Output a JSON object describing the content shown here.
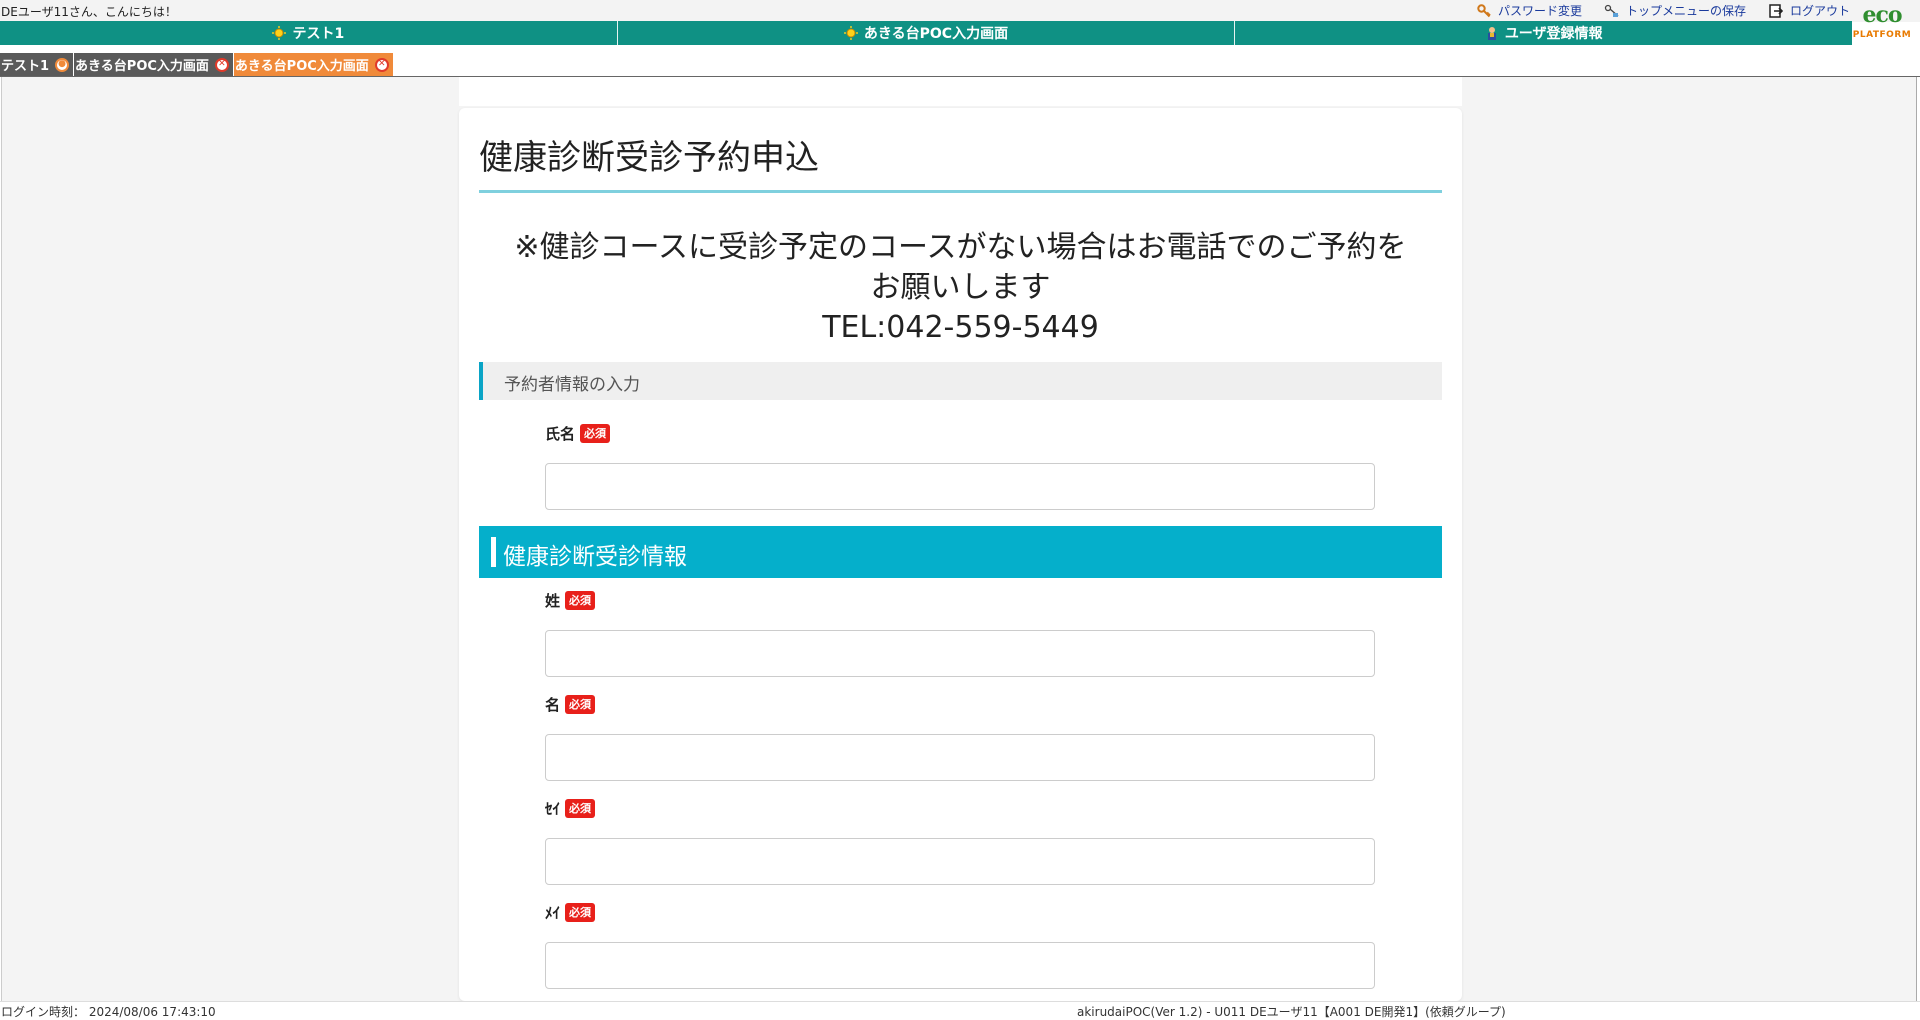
{
  "header": {
    "greeting": "DEユーザ11さん、こんにちは！",
    "links": [
      {
        "label": "パスワード変更",
        "icon": "key-icon"
      },
      {
        "label": "トップメニューの保存",
        "icon": "save-menu-icon"
      },
      {
        "label": "ログアウト",
        "icon": "logout-icon"
      }
    ],
    "logo": {
      "mark": "eco",
      "sub": "PLATFORM"
    }
  },
  "nav": {
    "items": [
      {
        "label": "テスト1",
        "icon": "sun-icon"
      },
      {
        "label": "あきる台POC入力画面",
        "icon": "sun-icon"
      },
      {
        "label": "ユーザ登録情報",
        "icon": "user-icon"
      }
    ]
  },
  "tabs": [
    {
      "label": "テスト1",
      "state": "normal"
    },
    {
      "label": "あきる台POC入力画面",
      "state": "normal"
    },
    {
      "label": "あきる台POC入力画面",
      "state": "active"
    }
  ],
  "form": {
    "title": "健康診断受診予約申込",
    "notice_line1": "※健診コースに受診予定のコースがない場合はお電話でのご予約を",
    "notice_line2": "お願いします",
    "notice_line3": "TEL:042-559-5449",
    "section1": "予約者情報の入力",
    "section2": "健康診断受診情報",
    "required_label": "必須",
    "fields": [
      {
        "label": "氏名",
        "value": ""
      },
      {
        "label": "姓",
        "value": ""
      },
      {
        "label": "名",
        "value": ""
      },
      {
        "label": "ｾｲ",
        "value": ""
      },
      {
        "label": "ﾒｲ",
        "value": ""
      }
    ]
  },
  "status": {
    "login_time": "ログイン時刻： 2024/08/06 17:43:10",
    "app_info": "akirudaiPOC(Ver 1.2) - U011 DEユーザ11【A001 DE開発1】(依頼グループ)"
  },
  "colors": {
    "nav": "#0f9184",
    "accent": "#05afcb",
    "required": "#e8201a",
    "active_tab": "#f08a3a"
  }
}
